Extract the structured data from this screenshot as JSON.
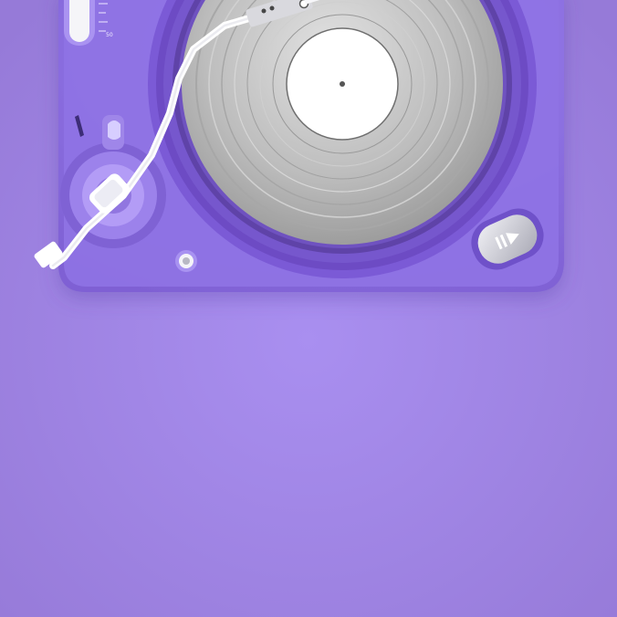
{
  "scene": {
    "subject": "turntable-top-view",
    "colors": {
      "background": "#9f86e4",
      "deck": "#8c6fe1",
      "record": "#b9b9b9",
      "label": "#ffffff",
      "tonearm": "#ffffff",
      "button": "#d7d7dc"
    }
  },
  "pitch_fader": {
    "label": "50"
  },
  "play_pause_button": {
    "icon": "play-pause-icon"
  }
}
